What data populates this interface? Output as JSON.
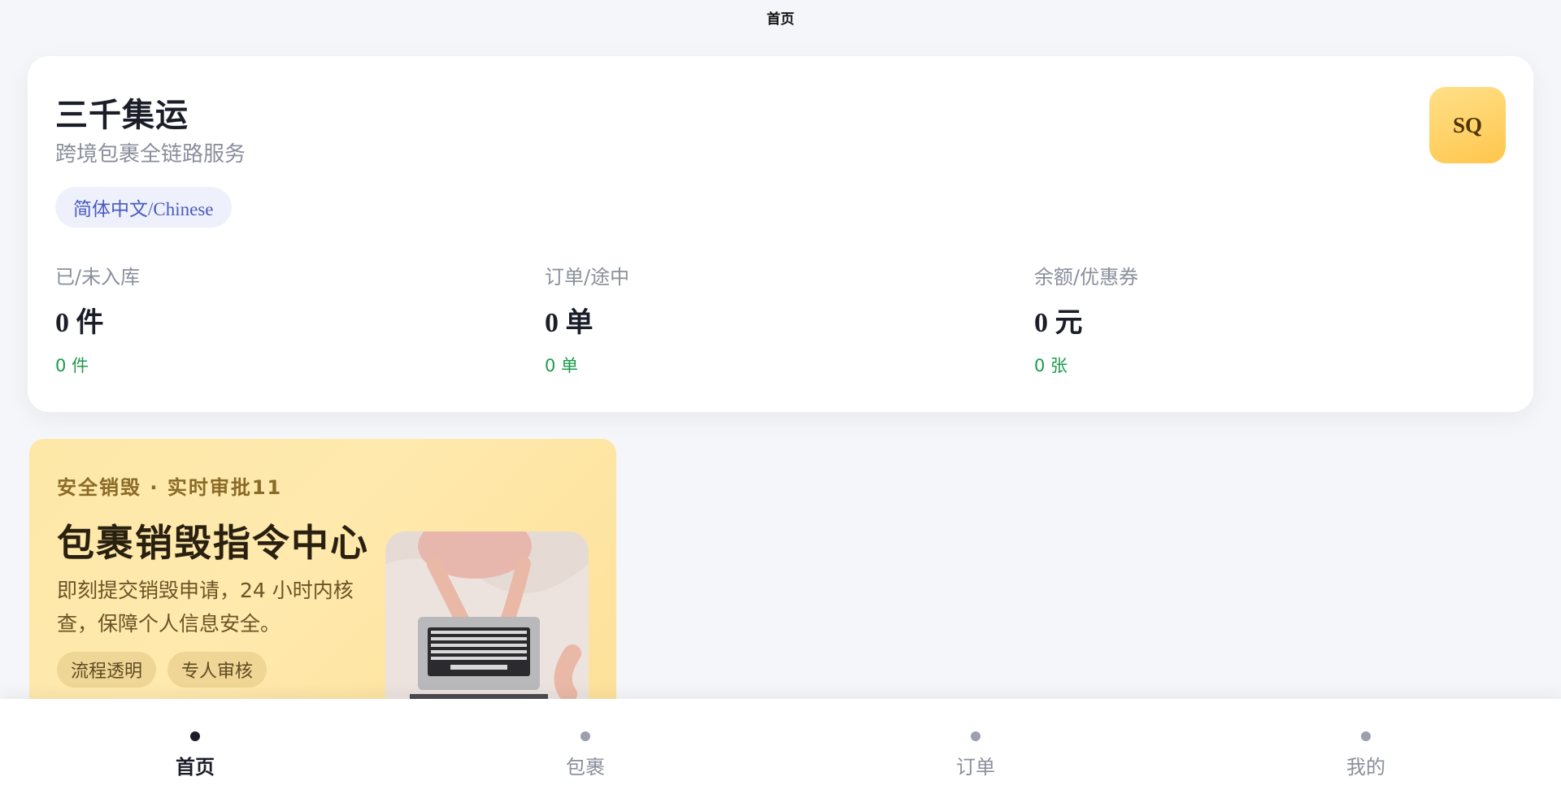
{
  "header": {
    "title": "首页"
  },
  "brand": {
    "title": "三千集运",
    "subtitle": "跨境包裹全链路服务",
    "language": "简体中文/Chinese",
    "avatar_initials": "SQ"
  },
  "stats": [
    {
      "label": "已/未入库",
      "value": "0 件",
      "sub": "0 件"
    },
    {
      "label": "订单/途中",
      "value": "0 单",
      "sub": "0 单"
    },
    {
      "label": "余额/优惠券",
      "value": "0 元",
      "sub": "0 张"
    }
  ],
  "promo": {
    "kicker": "安全销毁 · 实时审批11",
    "title": "包裹销毁指令中心",
    "description": "即刻提交销毁申请，24 小时内核查，保障个人信息安全。",
    "tags": [
      "流程透明",
      "专人审核"
    ]
  },
  "tabbar": {
    "items": [
      {
        "label": "首页",
        "active": true
      },
      {
        "label": "包裹",
        "active": false
      },
      {
        "label": "订单",
        "active": false
      },
      {
        "label": "我的",
        "active": false
      }
    ]
  },
  "colors": {
    "accent_green": "#1c9a4d",
    "language_pill": "#4a5bbf",
    "avatar_gold": "#ffc64c",
    "promo_bg": "#fde8a8"
  }
}
